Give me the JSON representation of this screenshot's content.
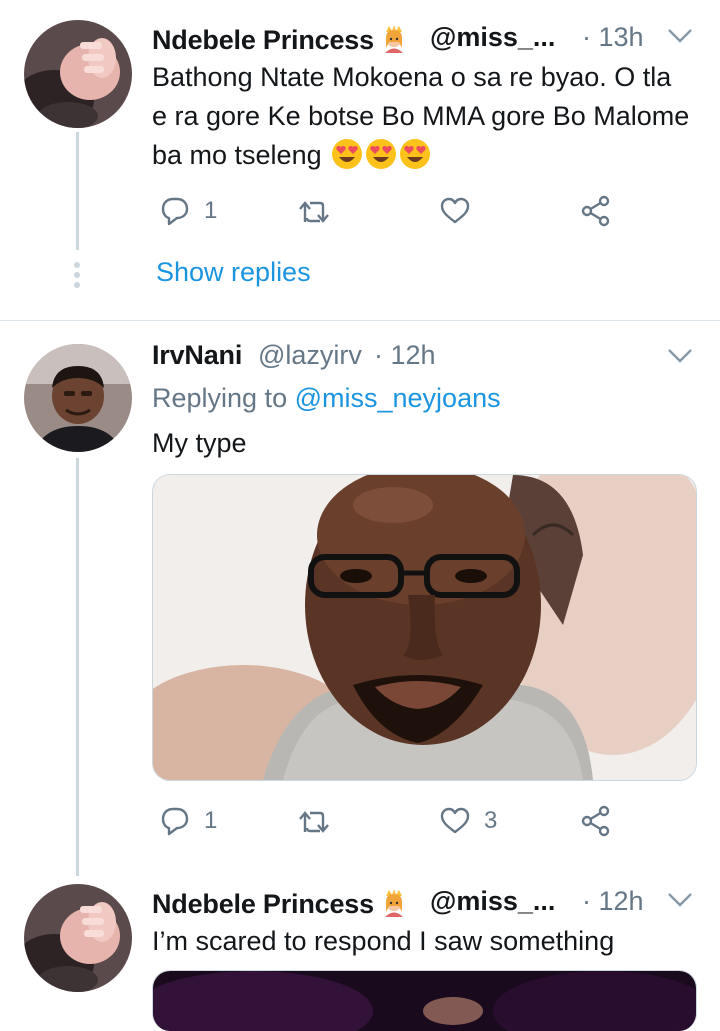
{
  "tweets": [
    {
      "name": "Ndebele Princess",
      "handle": "@miss_...",
      "time": "· 13h",
      "text": "Bathong Ntate Mokoena o sa re byao. O tla e ra gore Ke botse Bo MMA gore Bo Malome ba mo tseleng",
      "reply_count": "1",
      "retweet_count": "",
      "like_count": "",
      "show_replies": "Show replies"
    },
    {
      "name": "IrvNani",
      "handle": "@lazyirv",
      "time": "· 12h",
      "replying_prefix": "Replying to",
      "replying_to": "@miss_neyjoans",
      "text": "My type",
      "reply_count": "1",
      "retweet_count": "",
      "like_count": "3"
    },
    {
      "name": "Ndebele Princess",
      "handle": "@miss_...",
      "time": "· 12h",
      "text": "I’m scared to respond I saw something"
    }
  ],
  "icons": {
    "reply": "reply-icon",
    "retweet": "retweet-icon",
    "like": "heart-icon",
    "share": "share-icon",
    "menu": "chevron-down-icon",
    "emoji": "heart-eyes-emoji",
    "badge": "princess-emoji"
  },
  "colors": {
    "link": "#1b95e0",
    "secondary": "#657786",
    "thread_line": "#ccd6dd"
  }
}
